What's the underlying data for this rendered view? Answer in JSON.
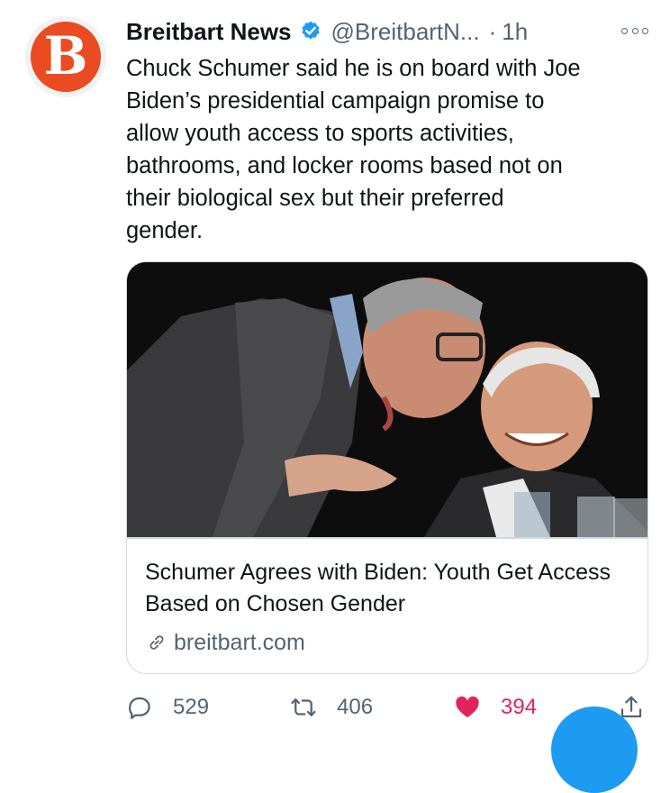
{
  "tweet": {
    "author_name": "Breitbart News",
    "handle": "@BreitbartN...",
    "separator": "·",
    "time": "1h",
    "avatar_letter": "B",
    "text": "Chuck Schumer said he is on board with Joe\nBiden’s presidential campaign promise to\nallow youth access to sports activities,\nbathrooms, and locker rooms based not on\ntheir biological sex but their preferred\ngender."
  },
  "card": {
    "title": "Schumer Agrees with Biden: Youth Get Access Based on Chosen Gender",
    "domain": "breitbart.com"
  },
  "actions": {
    "replies": "529",
    "retweets": "406",
    "likes": "394"
  },
  "icons": {
    "verified": "verified-badge-icon",
    "more": "more-dots-icon",
    "reply": "reply-bubble-icon",
    "retweet": "retweet-icon",
    "like": "heart-icon",
    "share": "share-upload-icon",
    "link": "link-icon"
  },
  "colors": {
    "brand_avatar": "#ea4b22",
    "verified": "#1d9bf0",
    "like_active": "#e0245e",
    "secondary_text": "#536471"
  }
}
